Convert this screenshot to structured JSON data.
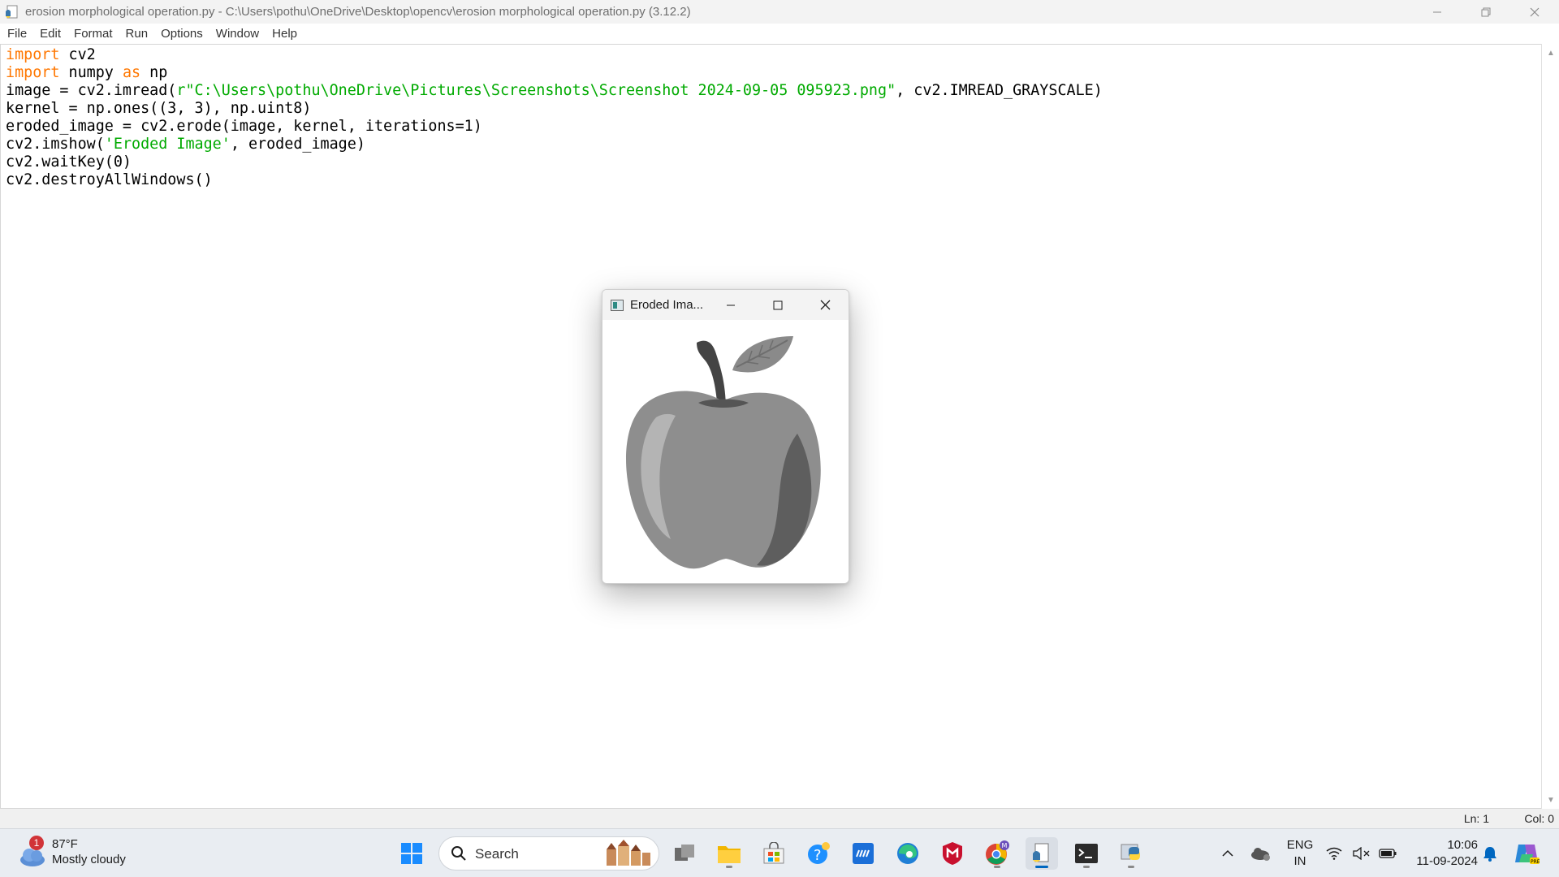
{
  "editor_window": {
    "title": "erosion morphological operation.py - C:\\Users\\pothu\\OneDrive\\Desktop\\opencv\\erosion morphological operation.py (3.12.2)"
  },
  "menu": {
    "file": "File",
    "edit": "Edit",
    "format": "Format",
    "run": "Run",
    "options": "Options",
    "window": "Window",
    "help": "Help"
  },
  "code": {
    "line1_kw": "import",
    "line1_rest": " cv2",
    "line2_kw": "import",
    "line2_mid": " numpy ",
    "line2_kw2": "as",
    "line2_rest": " np",
    "line3_pre": "image = cv2.imread(",
    "line3_str": "r\"C:\\Users\\pothu\\OneDrive\\Pictures\\Screenshots\\Screenshot 2024-09-05 095923.png\"",
    "line3_post": ", cv2.IMREAD_GRAYSCALE)",
    "line4": "kernel = np.ones((3, 3), np.uint8)",
    "line5": "eroded_image = cv2.erode(image, kernel, iterations=1)",
    "line6_pre": "cv2.imshow(",
    "line6_str": "'Eroded Image'",
    "line6_post": ", eroded_image)",
    "line7": "cv2.waitKey(0)",
    "line8": "cv2.destroyAllWindows()"
  },
  "status": {
    "line": "Ln: 1",
    "col": "Col: 0"
  },
  "image_window": {
    "title": "Eroded Ima..."
  },
  "taskbar": {
    "weather_temp": "87°F",
    "weather_desc": "Mostly cloudy",
    "weather_badge": "1",
    "search_label": "Search",
    "language_top": "ENG",
    "language_bottom": "IN",
    "time": "10:06",
    "date": "11-09-2024"
  },
  "colors": {
    "keyword": "#ff7700",
    "string": "#00aa00",
    "accent": "#0067c0"
  }
}
